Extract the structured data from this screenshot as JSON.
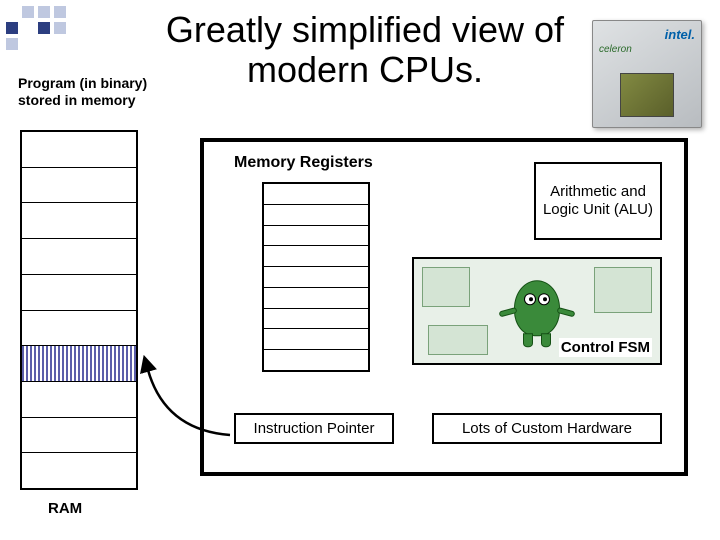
{
  "title": "Greatly simplified view of modern CPUs.",
  "program_label_line1": "Program (in binary)",
  "program_label_line2": "stored in memory",
  "ram_caption": "RAM",
  "ram_rows": 10,
  "ram_highlighted_row_index": 6,
  "cpu": {
    "memory_registers_label": "Memory Registers",
    "register_rows": 9,
    "alu_label": "Arithmetic and Logic Unit (ALU)",
    "control_fsm_label": "Control FSM",
    "instruction_pointer_label": "Instruction Pointer",
    "custom_hardware_label": "Lots of Custom Hardware"
  },
  "chip": {
    "brand": "intel.",
    "product": "celeron"
  }
}
